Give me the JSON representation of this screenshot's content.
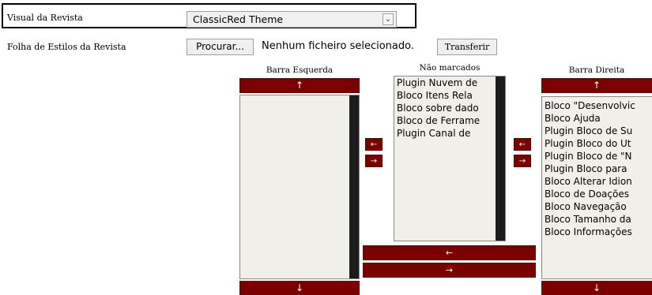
{
  "theme": {
    "label": "Visual da Revista",
    "selected": "ClassicRed Theme"
  },
  "stylesheet": {
    "label": "Folha de Estilos da Revista",
    "browse_button": "Procurar...",
    "file_status": "Nenhum ficheiro selecionado.",
    "upload_button": "Transferir"
  },
  "left_bar": {
    "title": "Barra Esquerda",
    "up": "↑",
    "down": "↓",
    "items": []
  },
  "unselected": {
    "title": "Não marcados",
    "items": [
      "Plugin Nuvem de",
      "Bloco Itens Rela",
      "Bloco sobre dado",
      "Bloco de Ferrame",
      "Plugin Canal de"
    ]
  },
  "right_bar": {
    "title": "Barra Direita",
    "up": "↑",
    "down": "↓",
    "items": [
      "Bloco \"Desenvolvic",
      "Bloco Ajuda",
      "Plugin Bloco de Su",
      "Plugin Bloco do Ut",
      "Plugin Bloco de \"N",
      "Plugin Bloco para",
      "Bloco Alterar Idion",
      "Bloco de Doações",
      "Bloco Navegação",
      "Bloco Tamanho da",
      "Bloco Informações"
    ]
  },
  "move_buttons": {
    "left": "←",
    "right": "→"
  },
  "colors": {
    "accent": "#7b0000",
    "scrollbar": "#1c1c1c",
    "list_bg": "#f0efe9"
  }
}
